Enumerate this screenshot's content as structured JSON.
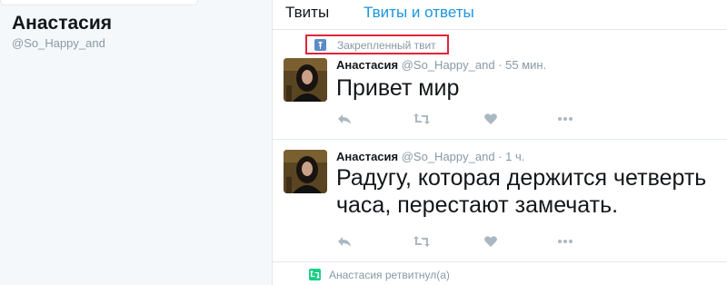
{
  "profile": {
    "name": "Анастасия",
    "handle": "@So_Happy_and"
  },
  "tabs": [
    {
      "label": "Твиты",
      "active": true
    },
    {
      "label": "Твиты и ответы",
      "active": false
    }
  ],
  "pinned_label": "Закрепленный твит",
  "tweets": [
    {
      "author": "Анастасия",
      "handle": "@So_Happy_and",
      "separator": "·",
      "time": "55 мин.",
      "text": "Привет мир"
    },
    {
      "author": "Анастасия",
      "handle": "@So_Happy_and",
      "separator": "·",
      "time": "1 ч.",
      "text": "Радугу, которая держится четверть\nчаса, перестают замечать."
    }
  ],
  "retweet_context": "Анастасия ретвитнул(а)",
  "icons": {
    "reply": "reply-icon",
    "retweet": "retweet-icon",
    "like": "heart-icon",
    "more": "more-icon",
    "pin": "pin-icon"
  },
  "colors": {
    "link": "#1b95e0",
    "highlight_border": "#e0243a",
    "muted": "#8899a6",
    "retweet_green": "#19cf86"
  }
}
